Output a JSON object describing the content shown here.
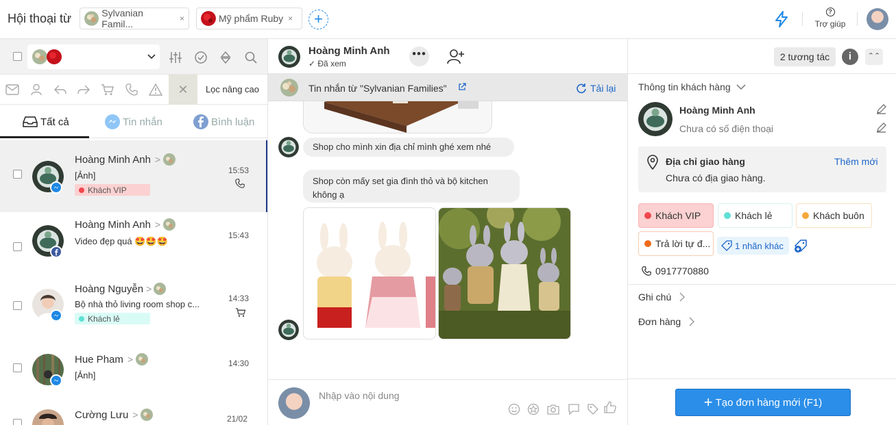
{
  "app_title": "Hội thoại từ",
  "page_tabs": [
    {
      "label": "Sylvanian Famil...",
      "close": "×"
    },
    {
      "label": "Mỹ phẩm Ruby",
      "close": "×"
    }
  ],
  "add_tab": "+",
  "help_label": "Trợ giúp",
  "help_symbol": "?",
  "filter": {
    "advanced_label": "Lọc nâng cao",
    "clear_symbol": "✕"
  },
  "tabs": [
    {
      "label": "Tất cả",
      "active": true
    },
    {
      "label": "Tin nhắn",
      "active": false
    },
    {
      "label": "Bình luận",
      "active": false
    }
  ],
  "conversations": [
    {
      "name": "Hoàng Minh Anh",
      "message": "[Ảnh]",
      "time": "15:53",
      "tag": "Khách VIP",
      "tag_color": "#f0484e",
      "tag_bg": "#fbd1d1",
      "channel": "messenger",
      "extra_icon": "phone-icon",
      "selected": true
    },
    {
      "name": "Hoàng Minh Anh",
      "message": "Video đẹp quá 🤩🤩🤩",
      "time": "15:43",
      "tag": "",
      "channel": "facebook",
      "extra_icon": "",
      "selected": false
    },
    {
      "name": "Hoàng Nguyễn",
      "message": "Bộ nhà thỏ living room shop c...",
      "time": "14:33",
      "tag": "Khách lẻ",
      "tag_color": "#5fe0d4",
      "tag_bg": "#d9fbf6",
      "channel": "messenger",
      "extra_icon": "cart-icon",
      "selected": false
    },
    {
      "name": "Hue Pham",
      "message": "[Ảnh]",
      "time": "14:30",
      "tag": "",
      "channel": "messenger",
      "extra_icon": "",
      "selected": false
    },
    {
      "name": "Cường Lưu",
      "message": "",
      "time": "21/02",
      "tag": "",
      "channel": "messenger",
      "extra_icon": "",
      "selected": false
    }
  ],
  "chat": {
    "name": "Hoàng Minh Anh",
    "seen": "Đã xem",
    "dots": "•••",
    "source": "Tin nhắn từ  \"Sylvanian Families\"",
    "reload": "Tải lại",
    "messages": [
      "Shop cho mình xin địa chỉ mình ghé xem nhé",
      "Shop còn mấy set gia đình thỏ và bộ kitchen không ạ"
    ],
    "composer_placeholder": "Nhập vào nội dung"
  },
  "right": {
    "interactions": "2 tương tác",
    "info_symbol": "i",
    "collapse_symbol": "⌃⌃",
    "section_title": "Thông tin khách hàng",
    "customer_name": "Hoàng Minh Anh",
    "customer_phone_empty": "Chưa có số điện thoại",
    "address_title": "Địa chỉ giao hàng",
    "address_add": "Thêm mới",
    "address_empty": "Chưa có địa giao hàng.",
    "tags": [
      {
        "label": "Khách VIP",
        "color": "#f0484e",
        "bg": "#fbd1d1",
        "border": "#f6b5b5"
      },
      {
        "label": "Khách lẻ",
        "color": "#5fe0d4",
        "bg": "#ffffff",
        "border": "#d6f3ef"
      },
      {
        "label": "Khách buôn",
        "color": "#f6a93b",
        "bg": "#ffffff",
        "border": "#f8e0bd"
      },
      {
        "label": "Trả lời tự đ...",
        "color": "#f06a1a",
        "bg": "#ffffff",
        "border": "#f8cdb0"
      }
    ],
    "more_tags": "1 nhãn khác",
    "phone": "0917770880",
    "notes": "Ghi chú",
    "orders": "Đơn hàng",
    "create_order": "Tạo đơn hàng mới (F1)",
    "create_plus": "+"
  },
  "colors": {
    "accent": "#1e88e5",
    "link": "#1e66c9",
    "button": "#2b8ee8"
  }
}
